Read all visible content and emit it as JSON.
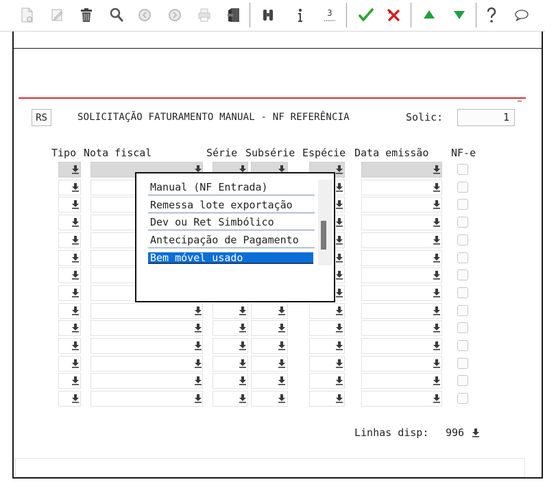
{
  "toolbar": {
    "buttons": [
      {
        "icon": "new-document-icon",
        "enabled": false
      },
      {
        "icon": "edit-icon",
        "enabled": false
      },
      {
        "icon": "trash-icon",
        "enabled": true
      },
      {
        "icon": "search-icon",
        "enabled": true
      },
      {
        "icon": "previous-icon",
        "enabled": false
      },
      {
        "icon": "next-icon",
        "enabled": false
      },
      {
        "icon": "print-icon",
        "enabled": false
      },
      {
        "icon": "exit-icon",
        "enabled": true
      },
      {
        "icon": "binoculars-icon",
        "enabled": true
      },
      {
        "icon": "info-icon",
        "enabled": true
      },
      {
        "icon": "list-icon",
        "enabled": true
      },
      {
        "icon": "confirm-icon",
        "enabled": true
      },
      {
        "icon": "cancel-icon",
        "enabled": true
      },
      {
        "icon": "up-arrow-icon",
        "enabled": true
      },
      {
        "icon": "down-arrow-icon",
        "enabled": true
      },
      {
        "icon": "help-icon",
        "enabled": true
      },
      {
        "icon": "chat-icon",
        "enabled": true
      }
    ],
    "list_icon_text": "3"
  },
  "form": {
    "code": "RS",
    "title": "SOLICITAÇÃO FATURAMENTO MANUAL - NF REFERÊNCIA",
    "solic_label": "Solic:",
    "solic_value": "1"
  },
  "columns": {
    "tipo": "Tipo",
    "nota_fiscal": "Nota fiscal",
    "serie": "Série",
    "subserie": "Subsérie",
    "especie": "Espécie",
    "data_emissao": "Data emissão",
    "nfe": "NF-e"
  },
  "grid": {
    "row_count": 14
  },
  "popup": {
    "items": [
      "Manual (NF Entrada)",
      "Remessa lote exportação",
      "Dev ou Ret Simbólico",
      "Antecipação de Pagamento",
      "Bem móvel usado"
    ],
    "selected_index": 4
  },
  "footer": {
    "linhas_label": "Linhas disp:",
    "linhas_value": "996"
  },
  "colors": {
    "accent_red": "#d93030",
    "selection_blue": "#0a6fd8",
    "confirm_green": "#2aa22a",
    "cancel_red": "#d42020"
  }
}
